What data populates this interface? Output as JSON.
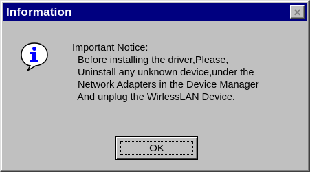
{
  "window": {
    "title": "Information",
    "close_glyph": "✕"
  },
  "icon": {
    "name": "information-icon",
    "glyph": "i",
    "color": "#0000ff"
  },
  "message": {
    "lines": [
      "Important Notice:",
      "  Before installing the driver,Please,",
      "  Uninstall any unknown device,under the",
      "  Network Adapters in the Device Manager",
      "  And unplug the WirlessLAN Device."
    ]
  },
  "buttons": {
    "ok_label": "OK"
  },
  "colors": {
    "titlebar": "#000080",
    "dialog_face": "#c0c0c0"
  }
}
